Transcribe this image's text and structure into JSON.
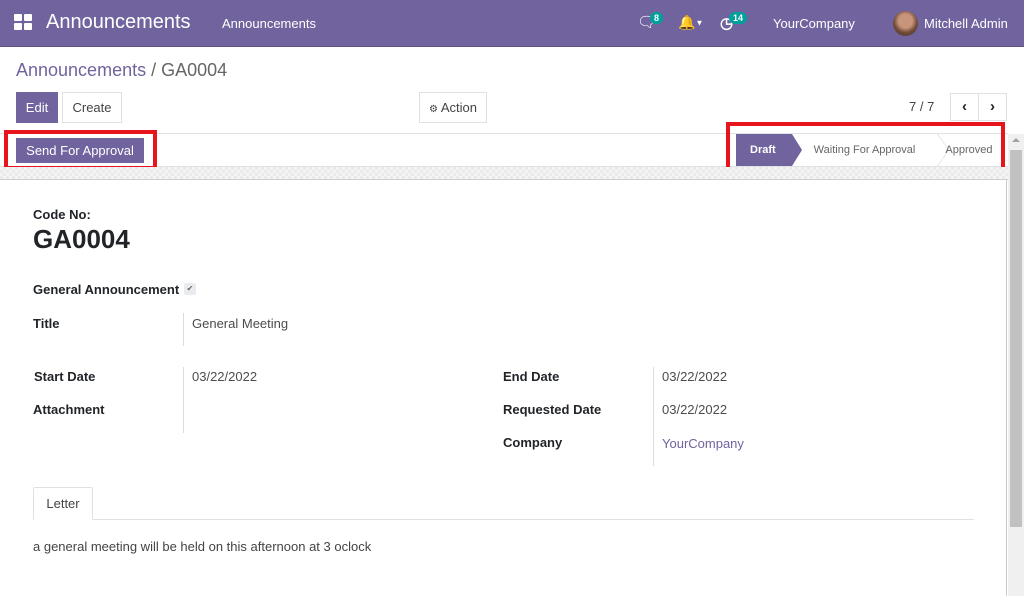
{
  "navbar": {
    "app_title": "Announcements",
    "menu_item": "Announcements",
    "messages_badge": "8",
    "activities_badge": "14",
    "company": "YourCompany",
    "user": "Mitchell Admin",
    "accent_color": "#71639e"
  },
  "breadcrumb": {
    "parent": "Announcements",
    "separator": "/",
    "current": "GA0004"
  },
  "control_panel": {
    "edit_label": "Edit",
    "create_label": "Create",
    "action_label": "Action",
    "pager": "7 / 7"
  },
  "statusbar": {
    "button_label": "Send For Approval",
    "stages": [
      {
        "label": "Draft",
        "active": true
      },
      {
        "label": "Waiting For Approval",
        "active": false
      },
      {
        "label": "Approved",
        "active": false
      }
    ]
  },
  "form": {
    "code_label": "Code No:",
    "code_value": "GA0004",
    "general_announcement_label": "General Announcement",
    "general_announcement_checked": true,
    "title_label": "Title",
    "title_value": "General Meeting",
    "start_date_label": "Start Date",
    "start_date_value": "03/22/2022",
    "attachment_label": "Attachment",
    "attachment_value": "",
    "end_date_label": "End Date",
    "end_date_value": "03/22/2022",
    "requested_date_label": "Requested Date",
    "requested_date_value": "03/22/2022",
    "company_label": "Company",
    "company_value": "YourCompany"
  },
  "notebook": {
    "tabs": [
      {
        "label": "Letter",
        "active": true
      }
    ],
    "letter_content": "a general meeting will be held on this afternoon at 3 oclock"
  }
}
